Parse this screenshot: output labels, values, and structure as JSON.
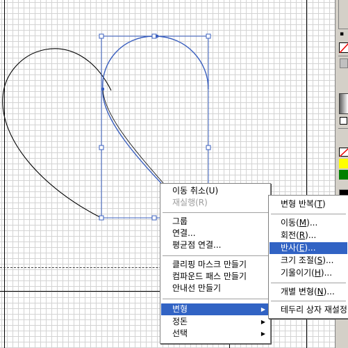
{
  "context_menu": {
    "items": [
      {
        "label": "이동 취소(U)",
        "enabled": true
      },
      {
        "label": "재실행(R)",
        "enabled": false
      },
      {
        "label": "그룹",
        "enabled": true
      },
      {
        "label": "연결...",
        "enabled": true
      },
      {
        "label": "평균점 연결...",
        "enabled": true
      },
      {
        "label": "클리핑 마스크 만들기",
        "enabled": true
      },
      {
        "label": "컴파운드 패스 만들기",
        "enabled": true
      },
      {
        "label": "안내선 만들기",
        "enabled": true
      },
      {
        "label": "변형",
        "enabled": true,
        "submenu": true,
        "highlighted": true
      },
      {
        "label": "정돈",
        "enabled": true,
        "submenu": true
      },
      {
        "label": "선택",
        "enabled": true,
        "submenu": true
      }
    ]
  },
  "transform_submenu": {
    "items": [
      {
        "label": "변형 반복",
        "key": "T",
        "suffix": ""
      },
      {
        "label": "이동",
        "key": "M",
        "suffix": "..."
      },
      {
        "label": "회전",
        "key": "R",
        "suffix": "..."
      },
      {
        "label": "반사",
        "key": "E",
        "suffix": "...",
        "highlighted": true
      },
      {
        "label": "크기 조절",
        "key": "S",
        "suffix": "..."
      },
      {
        "label": "기울이기",
        "key": "H",
        "suffix": "..."
      },
      {
        "label": "개별 변형",
        "key": "N",
        "suffix": "..."
      },
      {
        "label": "테두리 상자 재설정",
        "key": "",
        "suffix": ""
      }
    ]
  },
  "colors": {
    "selection": "#3a5fbf",
    "menu_highlight": "#3163c4",
    "swatch_yellow": "#ffff00",
    "swatch_green": "#008000",
    "panel_gray": "#d4d0c8"
  },
  "tool_icons": [
    "none-swatch-icon",
    "gradient-swatch-icon",
    "rectangle-icon",
    "yellow-swatch",
    "green-swatch",
    "black-swatch"
  ]
}
